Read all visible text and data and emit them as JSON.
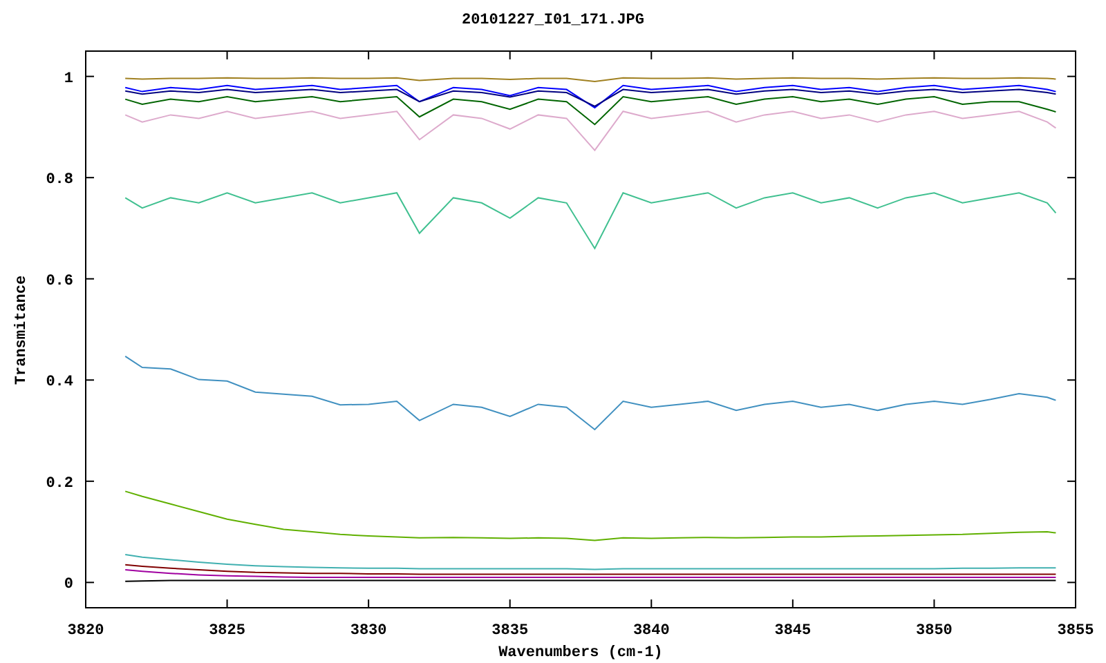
{
  "chart": {
    "chart_data": {
      "type": "line",
      "title": "20101227_I01_171.JPG",
      "xlabel": "Wavenumbers (cm-1)",
      "ylabel": "Transmitance",
      "x": [
        3821.4,
        3822,
        3823,
        3824,
        3825,
        3826,
        3827,
        3828,
        3829,
        3830,
        3831,
        3831.8,
        3833,
        3834,
        3835,
        3836,
        3837,
        3838,
        3839,
        3840,
        3841,
        3842,
        3843,
        3844,
        3845,
        3846,
        3847,
        3848,
        3849,
        3850,
        3851,
        3852,
        3853,
        3854,
        3854.3
      ],
      "xlim": [
        3820,
        3855
      ],
      "ylim": [
        -0.05,
        1.05
      ],
      "xticks": [
        3820,
        3825,
        3830,
        3835,
        3840,
        3845,
        3850,
        3855
      ],
      "yticks": [
        0,
        0.2,
        0.4,
        0.6,
        0.8,
        1
      ],
      "series": [
        {
          "color": "#a08020",
          "values": [
            0.996,
            0.995,
            0.996,
            0.996,
            0.997,
            0.996,
            0.996,
            0.997,
            0.996,
            0.996,
            0.997,
            0.992,
            0.996,
            0.996,
            0.994,
            0.996,
            0.996,
            0.99,
            0.997,
            0.996,
            0.996,
            0.997,
            0.995,
            0.996,
            0.997,
            0.996,
            0.996,
            0.995,
            0.996,
            0.997,
            0.996,
            0.996,
            0.997,
            0.996,
            0.995
          ]
        },
        {
          "color": "#0000ff",
          "values": [
            0.978,
            0.97,
            0.978,
            0.974,
            0.982,
            0.974,
            0.978,
            0.982,
            0.974,
            0.978,
            0.982,
            0.95,
            0.978,
            0.974,
            0.962,
            0.978,
            0.974,
            0.938,
            0.982,
            0.974,
            0.978,
            0.982,
            0.97,
            0.978,
            0.982,
            0.974,
            0.978,
            0.97,
            0.978,
            0.982,
            0.974,
            0.978,
            0.982,
            0.974,
            0.97
          ]
        },
        {
          "color": "#000080",
          "values": [
            0.971,
            0.965,
            0.971,
            0.968,
            0.974,
            0.968,
            0.971,
            0.974,
            0.968,
            0.971,
            0.974,
            0.95,
            0.971,
            0.968,
            0.959,
            0.971,
            0.968,
            0.941,
            0.974,
            0.968,
            0.971,
            0.974,
            0.965,
            0.971,
            0.974,
            0.968,
            0.971,
            0.965,
            0.971,
            0.974,
            0.968,
            0.971,
            0.974,
            0.968,
            0.965
          ]
        },
        {
          "color": "#006400",
          "values": [
            0.955,
            0.945,
            0.955,
            0.95,
            0.96,
            0.95,
            0.955,
            0.96,
            0.95,
            0.955,
            0.96,
            0.92,
            0.955,
            0.95,
            0.935,
            0.955,
            0.95,
            0.905,
            0.96,
            0.95,
            0.955,
            0.96,
            0.945,
            0.955,
            0.96,
            0.95,
            0.955,
            0.945,
            0.955,
            0.96,
            0.945,
            0.95,
            0.95,
            0.935,
            0.93
          ]
        },
        {
          "color": "#ddaacc",
          "values": [
            0.924,
            0.91,
            0.924,
            0.917,
            0.931,
            0.917,
            0.924,
            0.931,
            0.917,
            0.924,
            0.931,
            0.875,
            0.924,
            0.917,
            0.896,
            0.924,
            0.917,
            0.854,
            0.931,
            0.917,
            0.924,
            0.931,
            0.91,
            0.924,
            0.931,
            0.917,
            0.924,
            0.91,
            0.924,
            0.931,
            0.917,
            0.924,
            0.931,
            0.91,
            0.898
          ]
        },
        {
          "color": "#40c090",
          "values": [
            0.76,
            0.74,
            0.76,
            0.75,
            0.77,
            0.75,
            0.76,
            0.77,
            0.75,
            0.76,
            0.77,
            0.69,
            0.76,
            0.75,
            0.72,
            0.76,
            0.75,
            0.66,
            0.77,
            0.75,
            0.76,
            0.77,
            0.74,
            0.76,
            0.77,
            0.75,
            0.76,
            0.74,
            0.76,
            0.77,
            0.75,
            0.76,
            0.77,
            0.75,
            0.73
          ]
        },
        {
          "color": "#4090c0",
          "values": [
            0.447,
            0.425,
            0.422,
            0.401,
            0.398,
            0.376,
            0.372,
            0.368,
            0.351,
            0.352,
            0.358,
            0.32,
            0.352,
            0.346,
            0.328,
            0.352,
            0.346,
            0.302,
            0.358,
            0.346,
            0.352,
            0.358,
            0.34,
            0.352,
            0.358,
            0.346,
            0.352,
            0.34,
            0.352,
            0.358,
            0.352,
            0.362,
            0.373,
            0.366,
            0.36
          ]
        },
        {
          "color": "#60b000",
          "values": [
            0.18,
            0.17,
            0.155,
            0.14,
            0.125,
            0.115,
            0.105,
            0.1,
            0.095,
            0.092,
            0.09,
            0.088,
            0.089,
            0.088,
            0.087,
            0.088,
            0.087,
            0.083,
            0.088,
            0.087,
            0.088,
            0.089,
            0.088,
            0.089,
            0.09,
            0.09,
            0.091,
            0.092,
            0.093,
            0.094,
            0.095,
            0.097,
            0.099,
            0.1,
            0.098
          ]
        },
        {
          "color": "#40b0b0",
          "values": [
            0.055,
            0.05,
            0.045,
            0.04,
            0.036,
            0.033,
            0.031,
            0.03,
            0.029,
            0.028,
            0.028,
            0.027,
            0.027,
            0.027,
            0.027,
            0.027,
            0.027,
            0.026,
            0.027,
            0.027,
            0.027,
            0.027,
            0.027,
            0.027,
            0.027,
            0.027,
            0.027,
            0.027,
            0.027,
            0.027,
            0.028,
            0.028,
            0.029,
            0.029,
            0.029
          ]
        },
        {
          "color": "#800000",
          "values": [
            0.035,
            0.032,
            0.028,
            0.025,
            0.022,
            0.02,
            0.019,
            0.018,
            0.018,
            0.017,
            0.017,
            0.016,
            0.016,
            0.016,
            0.016,
            0.016,
            0.016,
            0.016,
            0.016,
            0.016,
            0.016,
            0.016,
            0.016,
            0.016,
            0.016,
            0.016,
            0.016,
            0.016,
            0.016,
            0.016,
            0.016,
            0.016,
            0.016,
            0.016,
            0.016
          ]
        },
        {
          "color": "#a000a0",
          "values": [
            0.025,
            0.022,
            0.018,
            0.015,
            0.013,
            0.012,
            0.011,
            0.01,
            0.01,
            0.01,
            0.01,
            0.01,
            0.01,
            0.01,
            0.01,
            0.01,
            0.01,
            0.01,
            0.01,
            0.01,
            0.01,
            0.01,
            0.01,
            0.01,
            0.01,
            0.01,
            0.01,
            0.01,
            0.01,
            0.01,
            0.01,
            0.01,
            0.01,
            0.01,
            0.01
          ]
        },
        {
          "color": "#000000",
          "values": [
            0.002,
            0.003,
            0.004,
            0.004,
            0.004,
            0.004,
            0.004,
            0.004,
            0.004,
            0.004,
            0.004,
            0.004,
            0.004,
            0.004,
            0.004,
            0.004,
            0.004,
            0.004,
            0.004,
            0.004,
            0.004,
            0.004,
            0.004,
            0.004,
            0.004,
            0.004,
            0.004,
            0.004,
            0.004,
            0.004,
            0.004,
            0.004,
            0.004,
            0.004,
            0.004
          ]
        }
      ]
    }
  }
}
